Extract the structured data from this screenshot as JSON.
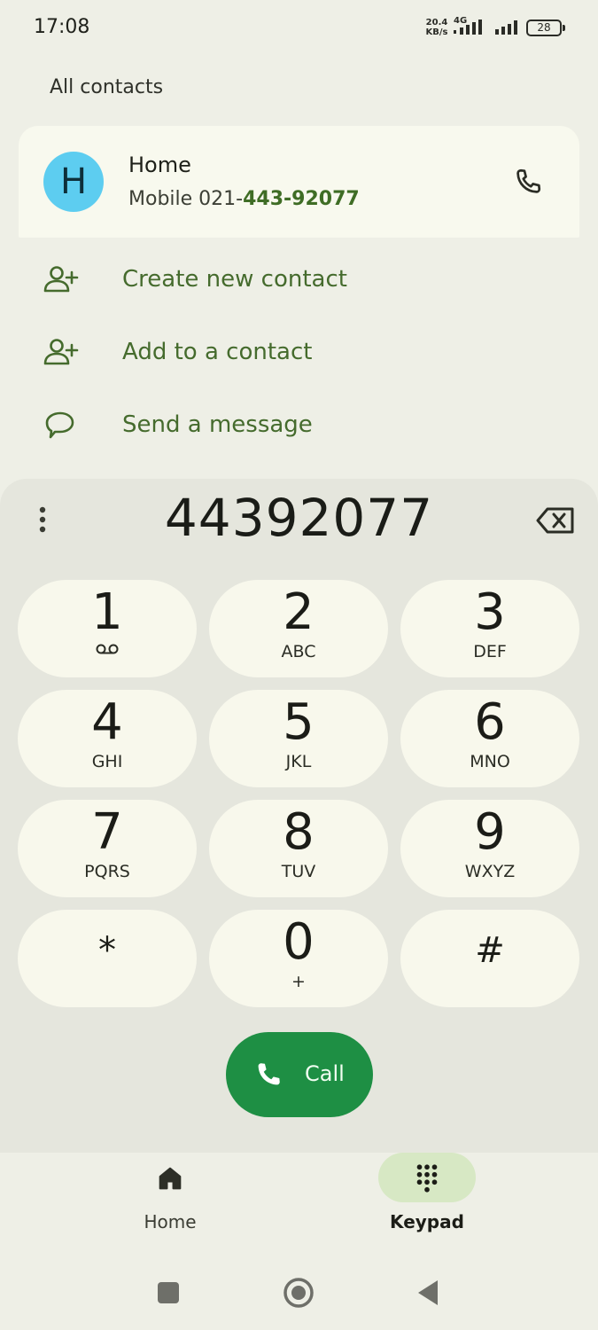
{
  "status": {
    "time": "17:08",
    "net_speed_value": "20.4",
    "net_speed_unit": "KB/s",
    "network_type": "4G",
    "battery": "28"
  },
  "header": {
    "title": "All contacts"
  },
  "contact": {
    "initial": "H",
    "name": "Home",
    "number_prefix": "Mobile 021-",
    "number_match": "443-92077",
    "avatar_color": "#5dcdf0"
  },
  "actions": [
    {
      "label": "Create new contact",
      "icon": "person-add-icon"
    },
    {
      "label": "Add to a contact",
      "icon": "person-add-icon"
    },
    {
      "label": "Send a message",
      "icon": "message-icon"
    }
  ],
  "dialer": {
    "number": "44392077",
    "keys": [
      {
        "digit": "1",
        "letters": ""
      },
      {
        "digit": "2",
        "letters": "ABC"
      },
      {
        "digit": "3",
        "letters": "DEF"
      },
      {
        "digit": "4",
        "letters": "GHI"
      },
      {
        "digit": "5",
        "letters": "JKL"
      },
      {
        "digit": "6",
        "letters": "MNO"
      },
      {
        "digit": "7",
        "letters": "PQRS"
      },
      {
        "digit": "8",
        "letters": "TUV"
      },
      {
        "digit": "9",
        "letters": "WXYZ"
      },
      {
        "digit": "*",
        "letters": ""
      },
      {
        "digit": "0",
        "letters": "+"
      },
      {
        "digit": "#",
        "letters": ""
      }
    ],
    "call_label": "Call",
    "call_color": "#1e8f44"
  },
  "bottom_nav": {
    "items": [
      {
        "label": "Home",
        "icon": "home-icon",
        "active": false
      },
      {
        "label": "Keypad",
        "icon": "dialpad-icon",
        "active": true
      }
    ],
    "active_color": "#d7e8c4"
  },
  "accent_color": "#456b2d"
}
